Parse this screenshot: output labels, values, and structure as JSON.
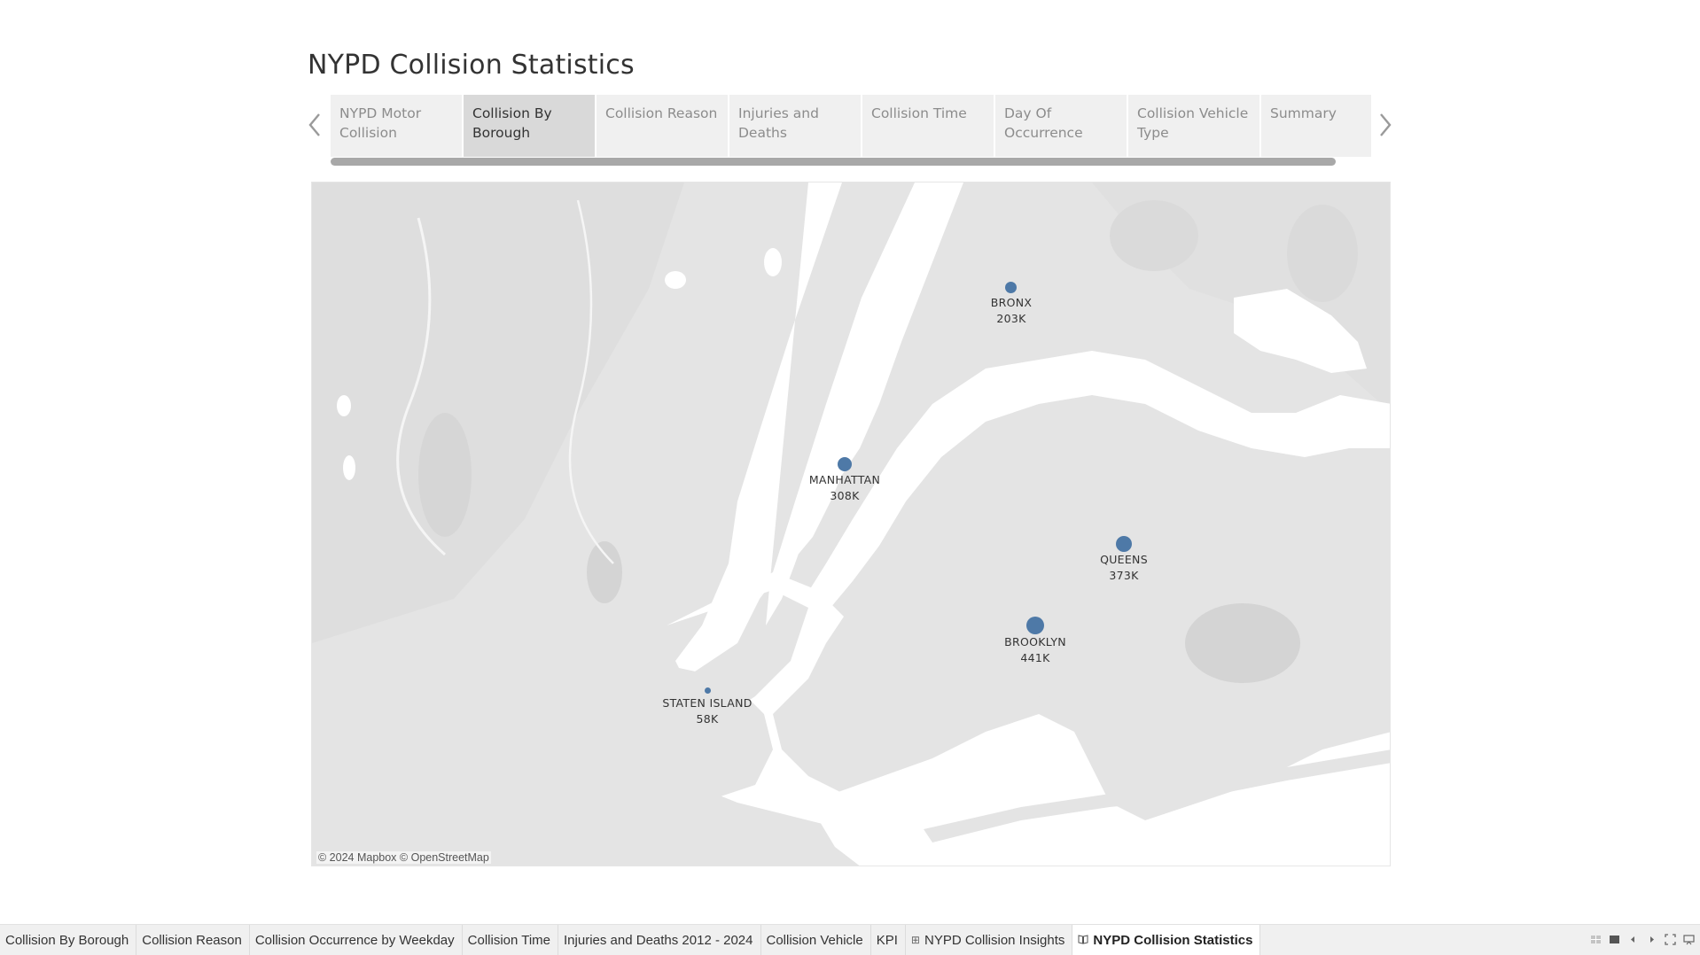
{
  "story": {
    "title": "NYPD Collision Statistics",
    "points": [
      {
        "label": "NYPD Motor Collision",
        "active": false
      },
      {
        "label": "Collision By Borough",
        "active": true
      },
      {
        "label": "Collision Reason",
        "active": false
      },
      {
        "label": "Injuries and Deaths",
        "active": false
      },
      {
        "label": "Collision Time",
        "active": false
      },
      {
        "label": "Day Of Occurrence",
        "active": false
      },
      {
        "label": "Collision Vehicle Type",
        "active": false
      },
      {
        "label": "Summary",
        "active": false
      }
    ],
    "prev_icon": "chevron-left-icon",
    "next_icon": "chevron-right-icon"
  },
  "map": {
    "marker_color": "#4e79a7",
    "attribution": "© 2024 Mapbox © OpenStreetMap",
    "boroughs": [
      {
        "name": "BRONX",
        "value_label": "203K"
      },
      {
        "name": "MANHATTAN",
        "value_label": "308K"
      },
      {
        "name": "QUEENS",
        "value_label": "373K"
      },
      {
        "name": "BROOKLYN",
        "value_label": "441K"
      },
      {
        "name": "STATEN ISLAND",
        "value_label": "58K"
      }
    ]
  },
  "tabs": [
    {
      "label": "Collision By Borough",
      "icon": "",
      "active": false
    },
    {
      "label": "Collision Reason",
      "icon": "",
      "active": false
    },
    {
      "label": "Collision Occurrence by Weekday",
      "icon": "",
      "active": false
    },
    {
      "label": "Collision Time",
      "icon": "",
      "active": false
    },
    {
      "label": "Injuries and Deaths 2012 - 2024",
      "icon": "",
      "active": false
    },
    {
      "label": "Collision Vehicle",
      "icon": "",
      "active": false
    },
    {
      "label": "KPI",
      "icon": "",
      "active": false
    },
    {
      "label": "NYPD Collision Insights",
      "icon": "dashboard-icon",
      "active": false
    },
    {
      "label": "NYPD Collision Statistics",
      "icon": "story-icon",
      "active": true
    }
  ],
  "tab_controls": [
    "show-sheet-sorter-icon",
    "show-filmstrip-icon",
    "previous-sheet-icon",
    "next-sheet-icon",
    "fullscreen-icon",
    "presentation-mode-icon"
  ]
}
